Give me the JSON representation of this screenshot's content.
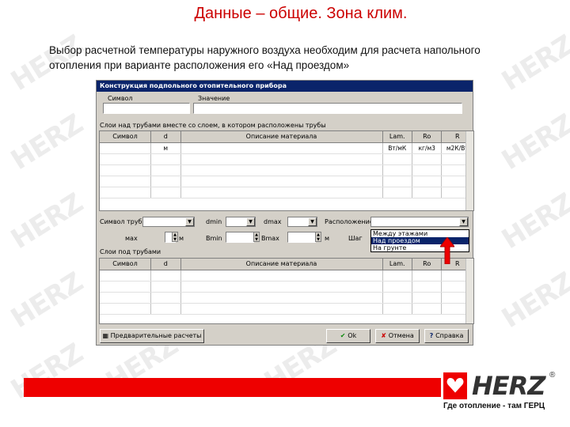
{
  "slide": {
    "title": "Данные – общие. Зона клим.",
    "text": "Выбор расчетной температуры наружного воздуха необходим для расчета напольного отопления при варианте расположения его «Над проездом»"
  },
  "dialog": {
    "title": "Конструкция подпольного отопительного прибора",
    "symbol_label": "Символ",
    "name_label": "Значение",
    "layer_label": "Слои над трубами вместе со слоем, в котором расположены трубы",
    "columns": [
      "Символ",
      "d",
      "Описание материала",
      "Lam.",
      "Ro",
      "R"
    ],
    "unit_row": [
      "",
      "м",
      "",
      "Вт/мК",
      "кг/м3",
      "м2К/Вт"
    ],
    "pipe_symbol_label": "Символ труб",
    "dmin_label": "dmin",
    "dmax_label": "dmax",
    "location_label": "Расположение",
    "location_options": [
      "Между этажами",
      "Над проездом",
      "На грунте"
    ],
    "location_selected_index": 1,
    "max_label": "мах",
    "m_unit": "м",
    "bmin_label": "Bmin",
    "bmax_label": "Bmax",
    "pitch_label": "Шаг",
    "under_label": "Слои под трубами",
    "columns2": [
      "Символ",
      "d",
      "Описание материала",
      "Lam.",
      "Ro",
      "R"
    ],
    "prelim_button": "Предварительные расчеты",
    "ok_button": "Ok",
    "cancel_button": "Отмена",
    "help_button": "Справка"
  },
  "brand": {
    "logo_text": "HERZ",
    "registered": "®",
    "tagline": "Где отопление - там ГЕРЦ",
    "watermark": "HERZ"
  },
  "colors": {
    "accent_red": "#ee0000",
    "title_red": "#cc0000",
    "win_title": "#0a246a",
    "win_face": "#d4d0c8"
  },
  "icons": {
    "ok": "green-check-icon",
    "cancel": "red-x-icon",
    "help": "question-icon",
    "annotation": "red-up-arrow-icon"
  }
}
